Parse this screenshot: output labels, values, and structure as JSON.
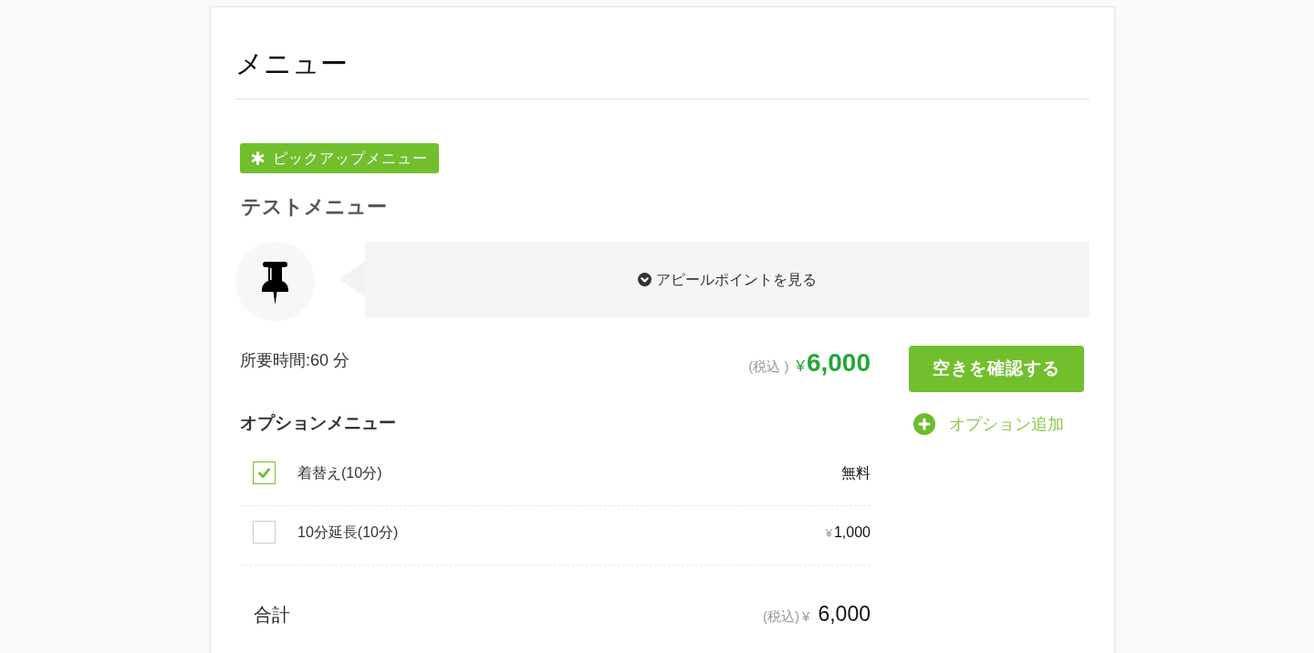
{
  "heading": "メニュー",
  "pickup_badge": "ピックアップメニュー",
  "item_name": "テストメニュー",
  "appeal_button": "アピールポイントを見る",
  "duration": "所要時間:60 分",
  "price": {
    "tax_note": "(税込 )",
    "currency": "¥",
    "amount": "6,000"
  },
  "check_availability_button": "空きを確認する",
  "options_heading": "オプションメニュー",
  "add_option_link": "オプション追加",
  "options": [
    {
      "label": "着替え(10分)",
      "price": "無料",
      "checked": true
    },
    {
      "label": "10分延長(10分)",
      "currency": "¥",
      "price": "1,000",
      "checked": false
    }
  ],
  "total": {
    "label": "合計",
    "tax_note": "(税込)",
    "currency": "¥",
    "amount": "6,000"
  }
}
